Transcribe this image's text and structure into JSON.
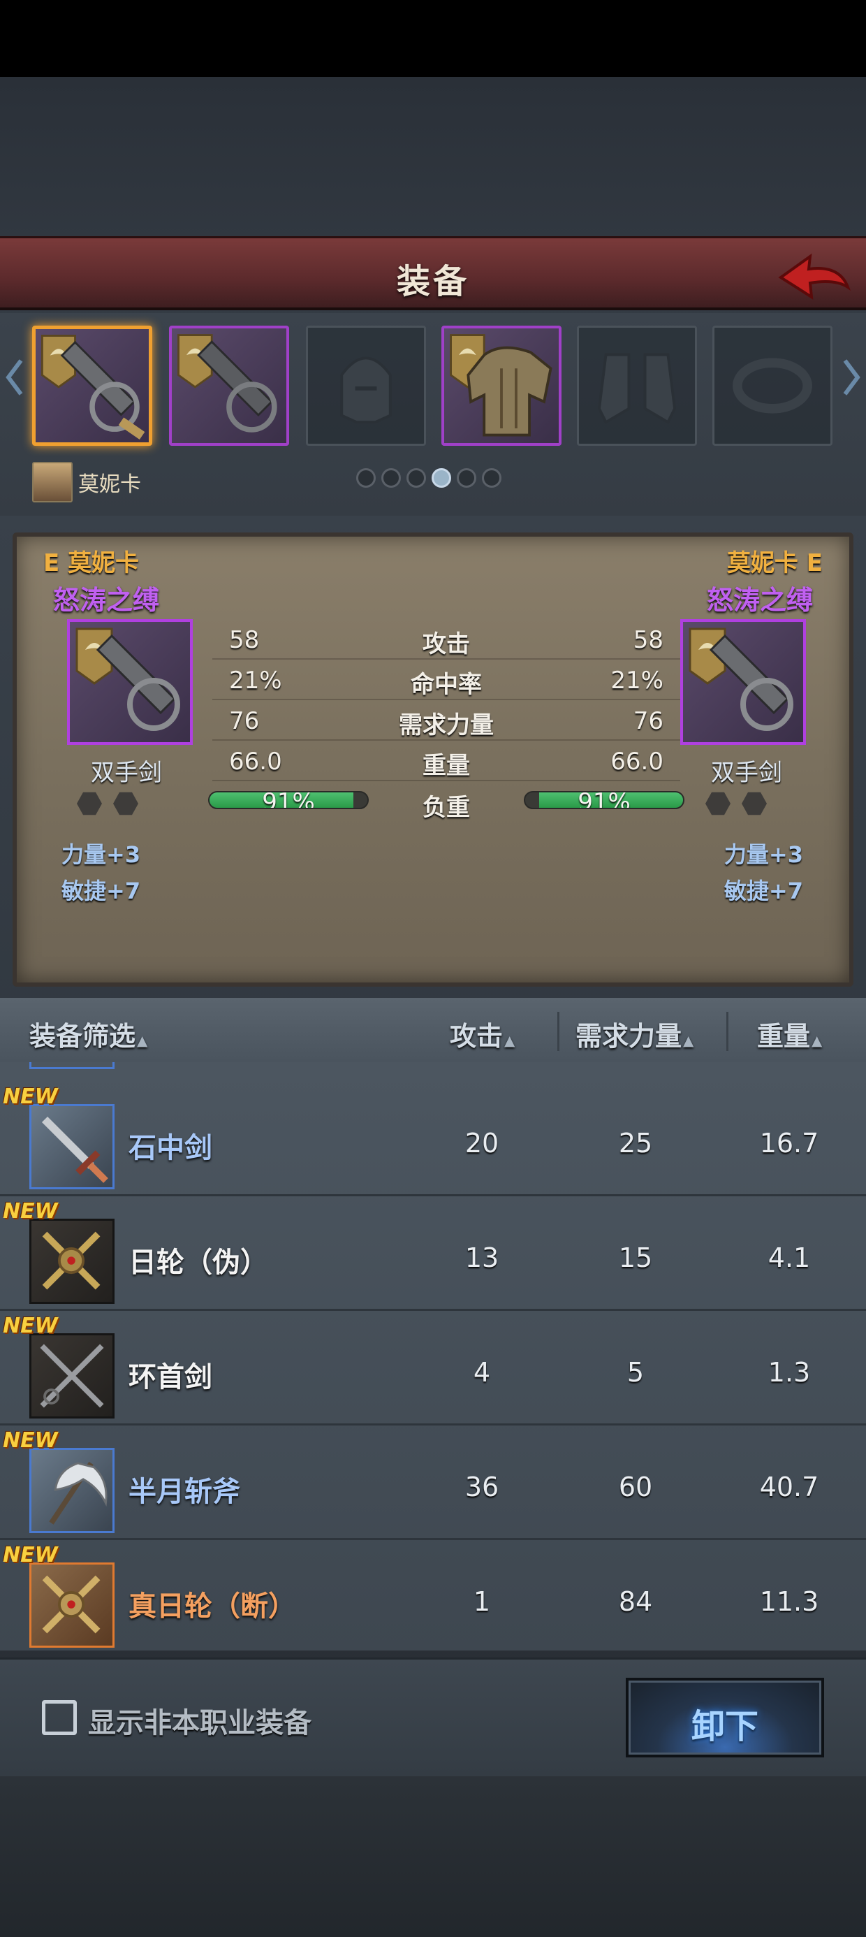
{
  "header": {
    "title": "装备"
  },
  "slots": [
    {
      "name": "slot-weapon-1",
      "state": "selected"
    },
    {
      "name": "slot-weapon-2",
      "state": "filled"
    },
    {
      "name": "slot-helmet",
      "state": "empty"
    },
    {
      "name": "slot-armor",
      "state": "filled"
    },
    {
      "name": "slot-boots",
      "state": "empty"
    },
    {
      "name": "slot-ring",
      "state": "empty"
    }
  ],
  "character": {
    "name": "莫妮卡",
    "page_dots": 6,
    "active_dot": 4
  },
  "compare": {
    "left": {
      "owner": "E 莫妮卡",
      "item_name": "怒涛之缚",
      "type": "双手剑",
      "bonuses": [
        "力量+3",
        "敏捷+7"
      ],
      "load_percent": 91,
      "load_text": "91%"
    },
    "right": {
      "owner": "莫妮卡 E",
      "item_name": "怒涛之缚",
      "type": "双手剑",
      "bonuses": [
        "力量+3",
        "敏捷+7"
      ],
      "load_percent": 91,
      "load_text": "91%"
    },
    "stats": [
      {
        "label": "攻击",
        "left": "58",
        "right": "58"
      },
      {
        "label": "命中率",
        "left": "21%",
        "right": "21%"
      },
      {
        "label": "需求力量",
        "left": "76",
        "right": "76"
      },
      {
        "label": "重量",
        "left": "66.0",
        "right": "66.0"
      }
    ],
    "load_label": "负重"
  },
  "filter": {
    "name_col": "装备筛选",
    "attack_col": "攻击",
    "str_col": "需求力量",
    "weight_col": "重量"
  },
  "items": [
    {
      "new": "NEW",
      "name": "石中剑",
      "attack": "20",
      "str": "25",
      "weight": "16.7",
      "rarity": "blue",
      "name_color": "#a8c8f8"
    },
    {
      "new": "NEW",
      "name": "日轮（伪）",
      "attack": "13",
      "str": "15",
      "weight": "4.1",
      "rarity": "black",
      "name_color": "#f4f4f4"
    },
    {
      "new": "NEW",
      "name": "环首剑",
      "attack": "4",
      "str": "5",
      "weight": "1.3",
      "rarity": "black",
      "name_color": "#f4f4f4"
    },
    {
      "new": "NEW",
      "name": "半月斩斧",
      "attack": "36",
      "str": "60",
      "weight": "40.7",
      "rarity": "blue",
      "name_color": "#a8c8f8"
    },
    {
      "new": "NEW",
      "name": "真日轮（断）",
      "attack": "1",
      "str": "84",
      "weight": "11.3",
      "rarity": "orange",
      "name_color": "#f4a060"
    }
  ],
  "footer": {
    "checkbox_label": "显示非本职业装备",
    "checked": false,
    "unequip_label": "卸下"
  },
  "colors": {
    "title_bar": "#5c2a2c",
    "legendary_purple": "#b040e0",
    "selected_gold": "#f0a030",
    "rare_blue": "#4a7ad0",
    "unique_orange": "#e07a30",
    "new_tag": "#f8d040"
  }
}
